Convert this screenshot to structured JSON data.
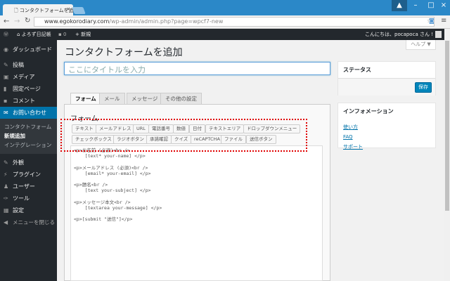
{
  "browser": {
    "tab_title": "コンタクトフォームを追加・よろ",
    "url_host": "www.egokorodiary.com",
    "url_path": "/wp-admin/admin.php?page=wpcf7-new"
  },
  "adminbar": {
    "site": "よろず日記帳",
    "comments": "0",
    "new": "新規",
    "greeting": "こんにちは、pocapoca さん !"
  },
  "sidebar": {
    "items": [
      {
        "label": "ダッシュボード",
        "icon": "dashboard-icon"
      },
      {
        "label": "投稿",
        "icon": "pin-icon"
      },
      {
        "label": "メディア",
        "icon": "media-icon"
      },
      {
        "label": "固定ページ",
        "icon": "page-icon"
      },
      {
        "label": "コメント",
        "icon": "comment-icon"
      },
      {
        "label": "お問い合わせ",
        "icon": "mail-icon"
      },
      {
        "label": "外観",
        "icon": "brush-icon"
      },
      {
        "label": "プラグイン",
        "icon": "plugin-icon"
      },
      {
        "label": "ユーザー",
        "icon": "user-icon"
      },
      {
        "label": "ツール",
        "icon": "wrench-icon"
      },
      {
        "label": "設定",
        "icon": "settings-icon"
      },
      {
        "label": "メニューを閉じる",
        "icon": "collapse-icon"
      }
    ],
    "submenu": [
      "コンタクトフォーム",
      "新規追加",
      "インテグレーション"
    ]
  },
  "help": "ヘルプ ▼",
  "page_title": "コンタクトフォームを追加",
  "title_placeholder": "ここにタイトルを入力",
  "tabs": [
    "フォーム",
    "メール",
    "メッセージ",
    "その他の設定"
  ],
  "form_heading": "フォーム",
  "tag_buttons_row1": [
    "テキスト",
    "メールアドレス",
    "URL",
    "電話番号",
    "数値",
    "日付",
    "テキストエリア",
    "ドロップダウンメニュー"
  ],
  "tag_buttons_row2": [
    "チェックボックス",
    "ラジオボタン",
    "承諾確認",
    "クイズ",
    "reCAPTCHA",
    "ファイル",
    "送信ボタン"
  ],
  "editor_text": "<p>お名前 (必須)<br />\n    [text* your-name] </p>\n\n<p>メールアドレス (必須)<br />\n    [email* your-email] </p>\n\n<p>題名<br />\n    [text your-subject] </p>\n\n<p>メッセージ本文<br />\n    [textarea your-message] </p>\n\n<p>[submit \"送信\"]</p>",
  "status": {
    "heading": "ステータス",
    "save": "保存"
  },
  "info": {
    "heading": "インフォメーション",
    "links": [
      "使い方",
      "FAQ",
      "サポート"
    ]
  }
}
